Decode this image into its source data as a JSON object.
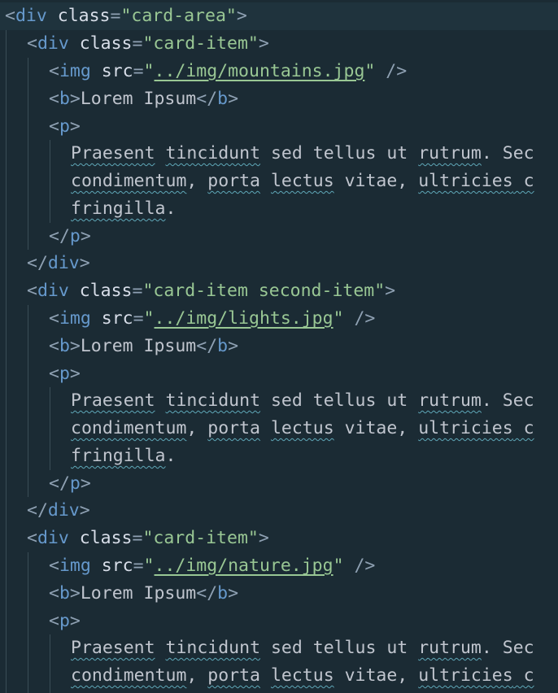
{
  "editor": {
    "theme_colors": {
      "background": "#1b2b34",
      "current_line": "#1f333d",
      "punctuation": "#8fa1b3",
      "tag": "#6699cc",
      "attribute": "#d8dee9",
      "string": "#99c794",
      "text": "#c0c5ce",
      "spellcheck_squiggle": "#5fa8b8"
    },
    "code": {
      "outer_div": {
        "tag": "div",
        "attr": "class",
        "value": "card-area"
      },
      "cards": [
        {
          "class_value": "card-item",
          "img_src": "../img/mountains.jpg",
          "title": "Lorem Ipsum",
          "words": {
            "w1": "Praesent",
            "w2": "tincidunt",
            "w3": "sed tellus ut",
            "w4": "rutrum",
            "w5": ". Sec",
            "w6": "condimentum",
            "w7": ", ",
            "w8": "porta",
            "w9": " ",
            "w10": "lectus",
            "w11": " vitae, ",
            "w12": "ultricies",
            "w13": " c",
            "w14": "fringilla",
            "w15": "."
          }
        },
        {
          "class_value": "card-item second-item",
          "img_src": "../img/lights.jpg",
          "title": "Lorem Ipsum",
          "words": {
            "w1": "Praesent",
            "w2": "tincidunt",
            "w3": "sed tellus ut",
            "w4": "rutrum",
            "w5": ". Sec",
            "w6": "condimentum",
            "w7": ", ",
            "w8": "porta",
            "w9": " ",
            "w10": "lectus",
            "w11": " vitae, ",
            "w12": "ultricies",
            "w13": " c",
            "w14": "fringilla",
            "w15": "."
          }
        },
        {
          "class_value": "card-item",
          "img_src": "../img/nature.jpg",
          "title": "Lorem Ipsum",
          "words": {
            "w1": "Praesent",
            "w2": "tincidunt",
            "w3": "sed tellus ut",
            "w4": "rutrum",
            "w5": ". Sec",
            "w6": "condimentum",
            "w7": ", ",
            "w8": "porta",
            "w9": " ",
            "w10": "lectus",
            "w11": " vitae, ",
            "w12": "ultricies",
            "w13": " c"
          }
        }
      ]
    }
  }
}
